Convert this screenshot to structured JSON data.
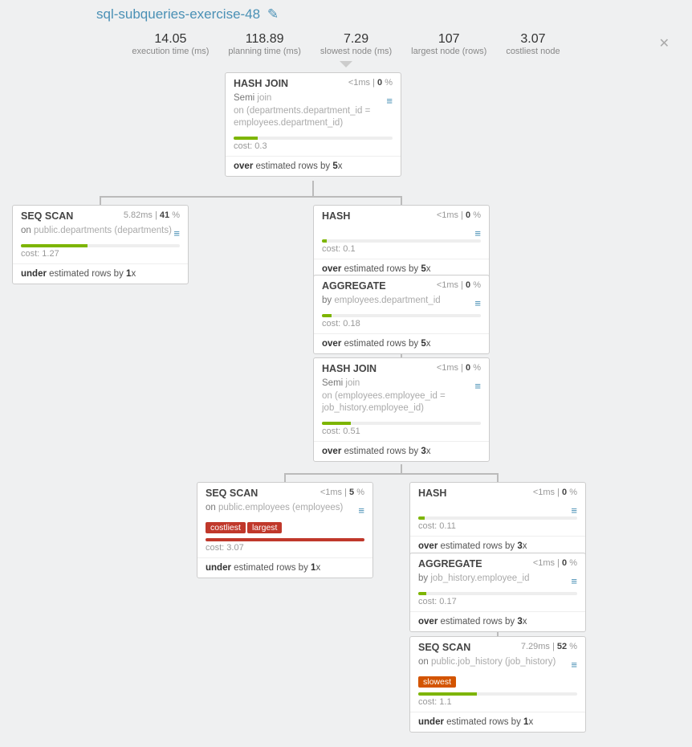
{
  "title": "sql-subqueries-exercise-48",
  "stats": {
    "exec_val": "14.05",
    "exec_lbl": "execution time (ms)",
    "plan_val": "118.89",
    "plan_lbl": "planning time (ms)",
    "slow_val": "7.29",
    "slow_lbl": "slowest node (ms)",
    "large_val": "107",
    "large_lbl": "largest node (rows)",
    "cost_val": "3.07",
    "cost_lbl": "costliest node"
  },
  "nodes": {
    "n1": {
      "title": "HASH JOIN",
      "ms": "<1ms",
      "pct": "0",
      "desc_pre": "Semi ",
      "desc_gray": "join",
      "desc2": "on (departments.department_id = employees.department_id)",
      "cost": "cost: 0.3",
      "bar": 15,
      "barcolor": "green",
      "est_b": "over",
      "est_mid": " estimated rows by ",
      "est_x": "5"
    },
    "n2": {
      "title": "SEQ SCAN",
      "ms": "5.82ms",
      "pct": "41",
      "desc_pre": "on ",
      "desc_gray": "public.departments (departments)",
      "cost": "cost: 1.27",
      "bar": 42,
      "barcolor": "green",
      "est_b": "under",
      "est_mid": " estimated rows by ",
      "est_x": "1"
    },
    "n3": {
      "title": "HASH",
      "ms": "<1ms",
      "pct": "0",
      "cost": "cost: 0.1",
      "bar": 3,
      "barcolor": "green",
      "est_b": "over",
      "est_mid": " estimated rows by ",
      "est_x": "5"
    },
    "n4": {
      "title": "AGGREGATE",
      "ms": "<1ms",
      "pct": "0",
      "desc_pre": "by ",
      "desc_gray": "employees.department_id",
      "cost": "cost: 0.18",
      "bar": 6,
      "barcolor": "green",
      "est_b": "over",
      "est_mid": " estimated rows by ",
      "est_x": "5"
    },
    "n5": {
      "title": "HASH JOIN",
      "ms": "<1ms",
      "pct": "0",
      "desc_pre": "Semi ",
      "desc_gray": "join",
      "desc2": "on (employees.employee_id = job_history.employee_id)",
      "cost": "cost: 0.51",
      "bar": 18,
      "barcolor": "green",
      "est_b": "over",
      "est_mid": " estimated rows by ",
      "est_x": "3"
    },
    "n6": {
      "title": "SEQ SCAN",
      "ms": "<1ms",
      "pct": "5",
      "desc_pre": "on ",
      "desc_gray": "public.employees (employees)",
      "badge1": "costliest",
      "badge2": "largest",
      "cost": "cost: 3.07",
      "bar": 100,
      "barcolor": "red",
      "est_b": "under",
      "est_mid": " estimated rows by ",
      "est_x": "1"
    },
    "n7": {
      "title": "HASH",
      "ms": "<1ms",
      "pct": "0",
      "cost": "cost: 0.11",
      "bar": 4,
      "barcolor": "green",
      "est_b": "over",
      "est_mid": " estimated rows by ",
      "est_x": "3"
    },
    "n8": {
      "title": "AGGREGATE",
      "ms": "<1ms",
      "pct": "0",
      "desc_pre": "by ",
      "desc_gray": "job_history.employee_id",
      "cost": "cost: 0.17",
      "bar": 5,
      "barcolor": "green",
      "est_b": "over",
      "est_mid": " estimated rows by ",
      "est_x": "3"
    },
    "n9": {
      "title": "SEQ SCAN",
      "ms": "7.29ms",
      "pct": "52",
      "desc_pre": "on ",
      "desc_gray": "public.job_history (job_history)",
      "badge1": "slowest",
      "cost": "cost: 1.1",
      "bar": 37,
      "barcolor": "green",
      "est_b": "under",
      "est_mid": " estimated rows by ",
      "est_x": "1"
    }
  },
  "labels": {
    "pct_suffix": " %",
    "x_suffix": "x"
  }
}
